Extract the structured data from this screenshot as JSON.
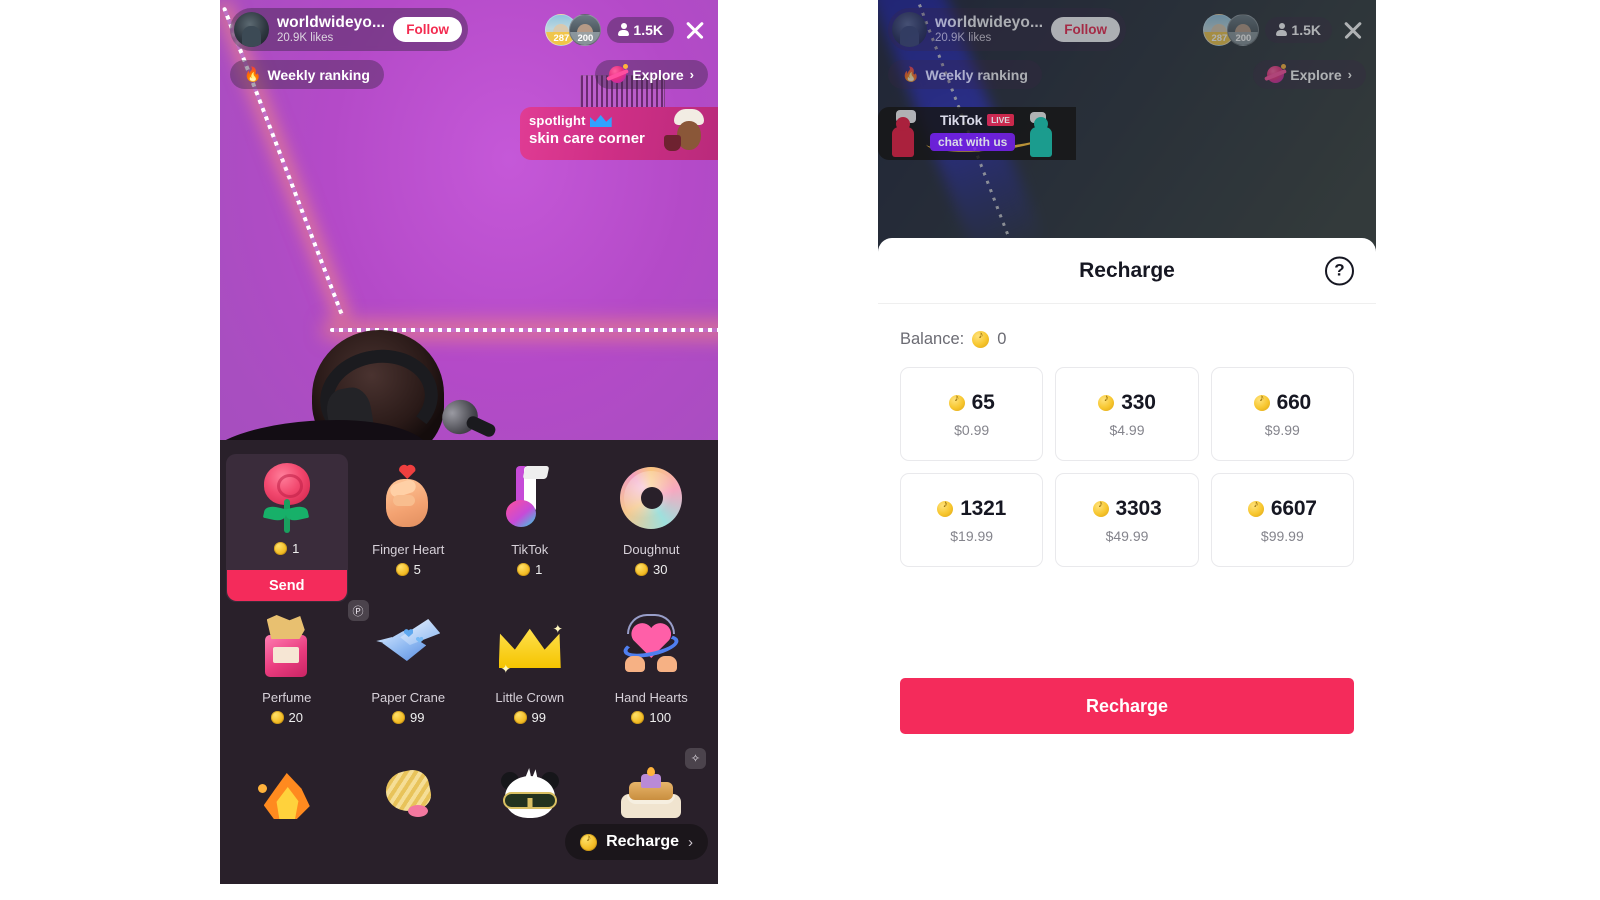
{
  "live": {
    "host": {
      "name": "worldwideyo...",
      "likes": "20.9K likes",
      "follow_label": "Follow"
    },
    "top_gifters": [
      {
        "rank_badge": "287"
      },
      {
        "rank_badge": "200"
      }
    ],
    "viewer_count": "1.5K",
    "chips": {
      "weekly_ranking": "Weekly ranking",
      "weekly_ranking_icon": "flame-icon",
      "explore": "Explore",
      "explore_icon": "planet-icon",
      "chevron": "›"
    },
    "close_icon": "close-icon"
  },
  "promo_left": {
    "line1": "spotlight",
    "line2": "skin care corner",
    "icon": "crown-icon"
  },
  "promo_right": {
    "logo": "TikTok",
    "live_badge": "LIVE",
    "chat_label": "chat with us"
  },
  "gift_panel": {
    "gifts": [
      {
        "name": "",
        "price": "1",
        "art": "rose-icon",
        "selected": true,
        "send_label": "Send"
      },
      {
        "name": "Finger Heart",
        "price": "5",
        "art": "finger-heart-icon"
      },
      {
        "name": "TikTok",
        "price": "1",
        "art": "tiktok-note-icon"
      },
      {
        "name": "Doughnut",
        "price": "30",
        "art": "doughnut-icon"
      },
      {
        "name": "Perfume",
        "price": "20",
        "art": "perfume-icon"
      },
      {
        "name": "Paper Crane",
        "price": "99",
        "art": "paper-crane-icon",
        "tag": "Ⓟ"
      },
      {
        "name": "Little Crown",
        "price": "99",
        "art": "crown-icon"
      },
      {
        "name": "Hand Hearts",
        "price": "100",
        "art": "hand-hearts-icon"
      },
      {
        "name": "",
        "price": "",
        "art": "flame-icon"
      },
      {
        "name": "",
        "price": "",
        "art": "corn-icon"
      },
      {
        "name": "",
        "price": "",
        "art": "panda-icon"
      },
      {
        "name": "",
        "price": "",
        "art": "cake-icon",
        "tag": "✧"
      }
    ],
    "recharge_pill": {
      "label": "Recharge",
      "chevron": "›",
      "coin_icon": "coin-icon"
    }
  },
  "recharge_sheet": {
    "title": "Recharge",
    "help_icon": "question-mark-icon",
    "help_glyph": "?",
    "balance_label": "Balance:",
    "balance_value": "0",
    "balance_coin_icon": "coin-icon",
    "packages": [
      {
        "coins": "65",
        "price": "$0.99"
      },
      {
        "coins": "330",
        "price": "$4.99"
      },
      {
        "coins": "660",
        "price": "$9.99"
      },
      {
        "coins": "1321",
        "price": "$19.99"
      },
      {
        "coins": "3303",
        "price": "$49.99"
      },
      {
        "coins": "6607",
        "price": "$99.99"
      }
    ],
    "cta_label": "Recharge"
  },
  "colors": {
    "accent_red": "#f42b5b",
    "coin_gold": "#f7c62e",
    "panel_dark": "#29202a",
    "text_dark": "#161722"
  }
}
